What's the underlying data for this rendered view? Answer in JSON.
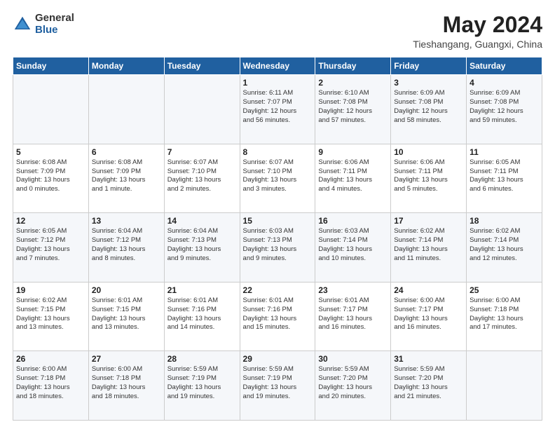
{
  "logo": {
    "general": "General",
    "blue": "Blue"
  },
  "header": {
    "month": "May 2024",
    "location": "Tieshangang, Guangxi, China"
  },
  "weekdays": [
    "Sunday",
    "Monday",
    "Tuesday",
    "Wednesday",
    "Thursday",
    "Friday",
    "Saturday"
  ],
  "weeks": [
    [
      {
        "day": "",
        "info": ""
      },
      {
        "day": "",
        "info": ""
      },
      {
        "day": "",
        "info": ""
      },
      {
        "day": "1",
        "info": "Sunrise: 6:11 AM\nSunset: 7:07 PM\nDaylight: 12 hours\nand 56 minutes."
      },
      {
        "day": "2",
        "info": "Sunrise: 6:10 AM\nSunset: 7:08 PM\nDaylight: 12 hours\nand 57 minutes."
      },
      {
        "day": "3",
        "info": "Sunrise: 6:09 AM\nSunset: 7:08 PM\nDaylight: 12 hours\nand 58 minutes."
      },
      {
        "day": "4",
        "info": "Sunrise: 6:09 AM\nSunset: 7:08 PM\nDaylight: 12 hours\nand 59 minutes."
      }
    ],
    [
      {
        "day": "5",
        "info": "Sunrise: 6:08 AM\nSunset: 7:09 PM\nDaylight: 13 hours\nand 0 minutes."
      },
      {
        "day": "6",
        "info": "Sunrise: 6:08 AM\nSunset: 7:09 PM\nDaylight: 13 hours\nand 1 minute."
      },
      {
        "day": "7",
        "info": "Sunrise: 6:07 AM\nSunset: 7:10 PM\nDaylight: 13 hours\nand 2 minutes."
      },
      {
        "day": "8",
        "info": "Sunrise: 6:07 AM\nSunset: 7:10 PM\nDaylight: 13 hours\nand 3 minutes."
      },
      {
        "day": "9",
        "info": "Sunrise: 6:06 AM\nSunset: 7:11 PM\nDaylight: 13 hours\nand 4 minutes."
      },
      {
        "day": "10",
        "info": "Sunrise: 6:06 AM\nSunset: 7:11 PM\nDaylight: 13 hours\nand 5 minutes."
      },
      {
        "day": "11",
        "info": "Sunrise: 6:05 AM\nSunset: 7:11 PM\nDaylight: 13 hours\nand 6 minutes."
      }
    ],
    [
      {
        "day": "12",
        "info": "Sunrise: 6:05 AM\nSunset: 7:12 PM\nDaylight: 13 hours\nand 7 minutes."
      },
      {
        "day": "13",
        "info": "Sunrise: 6:04 AM\nSunset: 7:12 PM\nDaylight: 13 hours\nand 8 minutes."
      },
      {
        "day": "14",
        "info": "Sunrise: 6:04 AM\nSunset: 7:13 PM\nDaylight: 13 hours\nand 9 minutes."
      },
      {
        "day": "15",
        "info": "Sunrise: 6:03 AM\nSunset: 7:13 PM\nDaylight: 13 hours\nand 9 minutes."
      },
      {
        "day": "16",
        "info": "Sunrise: 6:03 AM\nSunset: 7:14 PM\nDaylight: 13 hours\nand 10 minutes."
      },
      {
        "day": "17",
        "info": "Sunrise: 6:02 AM\nSunset: 7:14 PM\nDaylight: 13 hours\nand 11 minutes."
      },
      {
        "day": "18",
        "info": "Sunrise: 6:02 AM\nSunset: 7:14 PM\nDaylight: 13 hours\nand 12 minutes."
      }
    ],
    [
      {
        "day": "19",
        "info": "Sunrise: 6:02 AM\nSunset: 7:15 PM\nDaylight: 13 hours\nand 13 minutes."
      },
      {
        "day": "20",
        "info": "Sunrise: 6:01 AM\nSunset: 7:15 PM\nDaylight: 13 hours\nand 13 minutes."
      },
      {
        "day": "21",
        "info": "Sunrise: 6:01 AM\nSunset: 7:16 PM\nDaylight: 13 hours\nand 14 minutes."
      },
      {
        "day": "22",
        "info": "Sunrise: 6:01 AM\nSunset: 7:16 PM\nDaylight: 13 hours\nand 15 minutes."
      },
      {
        "day": "23",
        "info": "Sunrise: 6:01 AM\nSunset: 7:17 PM\nDaylight: 13 hours\nand 16 minutes."
      },
      {
        "day": "24",
        "info": "Sunrise: 6:00 AM\nSunset: 7:17 PM\nDaylight: 13 hours\nand 16 minutes."
      },
      {
        "day": "25",
        "info": "Sunrise: 6:00 AM\nSunset: 7:18 PM\nDaylight: 13 hours\nand 17 minutes."
      }
    ],
    [
      {
        "day": "26",
        "info": "Sunrise: 6:00 AM\nSunset: 7:18 PM\nDaylight: 13 hours\nand 18 minutes."
      },
      {
        "day": "27",
        "info": "Sunrise: 6:00 AM\nSunset: 7:18 PM\nDaylight: 13 hours\nand 18 minutes."
      },
      {
        "day": "28",
        "info": "Sunrise: 5:59 AM\nSunset: 7:19 PM\nDaylight: 13 hours\nand 19 minutes."
      },
      {
        "day": "29",
        "info": "Sunrise: 5:59 AM\nSunset: 7:19 PM\nDaylight: 13 hours\nand 19 minutes."
      },
      {
        "day": "30",
        "info": "Sunrise: 5:59 AM\nSunset: 7:20 PM\nDaylight: 13 hours\nand 20 minutes."
      },
      {
        "day": "31",
        "info": "Sunrise: 5:59 AM\nSunset: 7:20 PM\nDaylight: 13 hours\nand 21 minutes."
      },
      {
        "day": "",
        "info": ""
      }
    ]
  ]
}
